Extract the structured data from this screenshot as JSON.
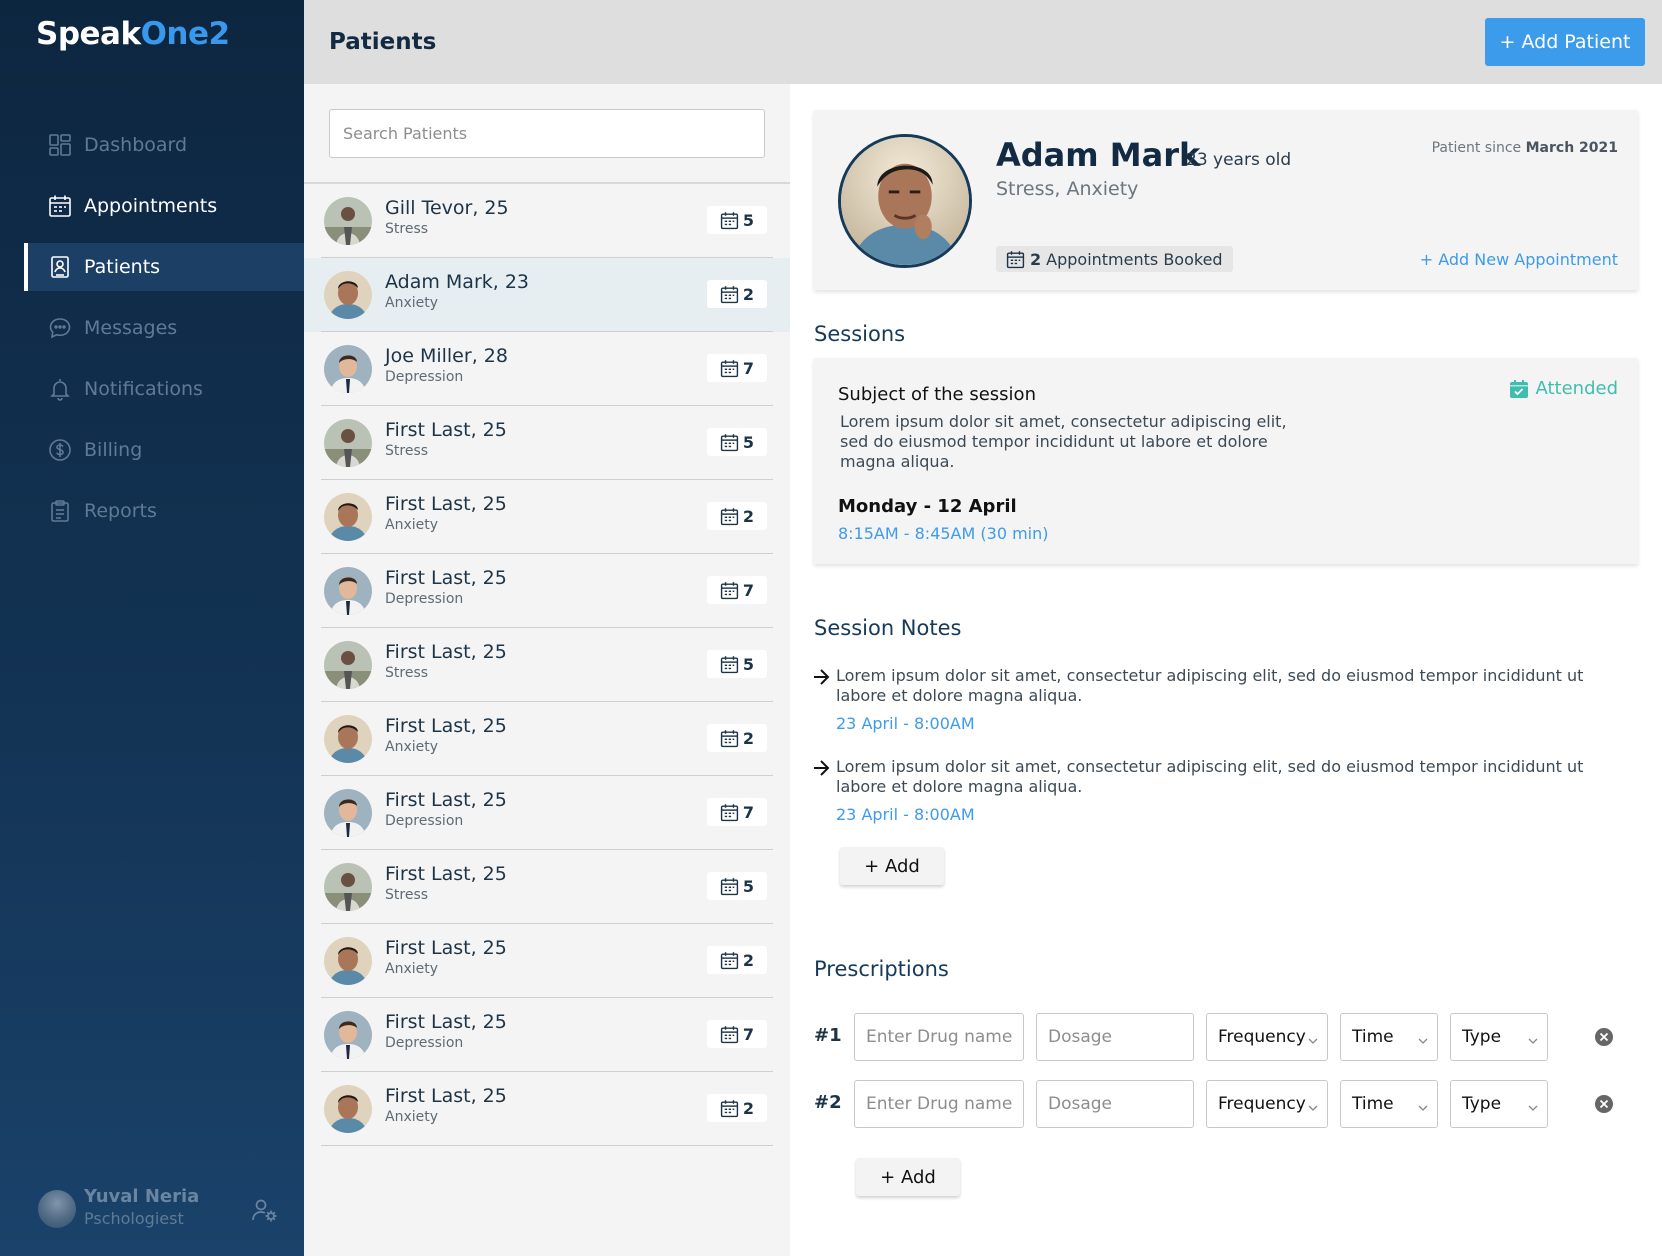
{
  "brand": {
    "part1": "Speak",
    "part2": "One2"
  },
  "sidebar": {
    "items": [
      {
        "label": "Dashboard",
        "icon": "dashboard-icon"
      },
      {
        "label": "Appointments",
        "icon": "calendar-icon"
      },
      {
        "label": "Patients",
        "icon": "patient-badge-icon"
      },
      {
        "label": "Messages",
        "icon": "chat-bubble-icon"
      },
      {
        "label": "Notifications",
        "icon": "bell-icon"
      },
      {
        "label": "Billing",
        "icon": "dollar-icon"
      },
      {
        "label": "Reports",
        "icon": "clipboard-icon"
      }
    ],
    "user": {
      "name": "Yuval Neria",
      "role": "Pschologiest",
      "settings_icon": "user-settings-icon"
    }
  },
  "header": {
    "title": "Patients",
    "add_button": "+ Add Patient"
  },
  "search": {
    "placeholder": "Search Patients"
  },
  "patients": [
    {
      "name": "Gill Tevor, 25",
      "condition": "Stress",
      "count": "5"
    },
    {
      "name": "Adam Mark, 23",
      "condition": "Anxiety",
      "count": "2"
    },
    {
      "name": "Joe Miller, 28",
      "condition": "Depression",
      "count": "7"
    },
    {
      "name": "First Last, 25",
      "condition": "Stress",
      "count": "5"
    },
    {
      "name": "First Last, 25",
      "condition": "Anxiety",
      "count": "2"
    },
    {
      "name": "First Last, 25",
      "condition": "Depression",
      "count": "7"
    },
    {
      "name": "First Last, 25",
      "condition": "Stress",
      "count": "5"
    },
    {
      "name": "First Last, 25",
      "condition": "Anxiety",
      "count": "2"
    },
    {
      "name": "First Last, 25",
      "condition": "Depression",
      "count": "7"
    },
    {
      "name": "First Last, 25",
      "condition": "Stress",
      "count": "5"
    },
    {
      "name": "First Last, 25",
      "condition": "Anxiety",
      "count": "2"
    },
    {
      "name": "First Last, 25",
      "condition": "Depression",
      "count": "7"
    },
    {
      "name": "First Last, 25",
      "condition": "Anxiety",
      "count": "2"
    }
  ],
  "profile": {
    "name": "Adam Mark",
    "age": "23 years old",
    "conditions": "Stress, Anxiety",
    "since_label": "Patient since",
    "since_value": "March 2021",
    "appointments_count": "2",
    "appointments_label": "Appointments Booked",
    "add_appointment": "+ Add New Appointment"
  },
  "sessions": {
    "title": "Sessions",
    "subject": "Subject of the session",
    "description": "Lorem ipsum dolor sit amet, consectetur adipiscing elit, sed do eiusmod tempor incididunt ut labore et dolore magna aliqua.",
    "date": "Monday - 12 April",
    "time": "8:15AM - 8:45AM (30 min)",
    "status": "Attended",
    "status_color": "#41bdb0"
  },
  "notes": {
    "title": "Session Notes",
    "items": [
      {
        "text": "Lorem ipsum dolor sit amet, consectetur adipiscing elit, sed do eiusmod tempor incididunt ut labore et dolore magna aliqua.",
        "when": "23 April - 8:00AM"
      },
      {
        "text": "Lorem ipsum dolor sit amet, consectetur adipiscing elit, sed do eiusmod tempor incididunt ut labore et dolore magna aliqua.",
        "when": "23 April - 8:00AM"
      }
    ],
    "add_label": "+ Add"
  },
  "prescriptions": {
    "title": "Prescriptions",
    "rows": [
      {
        "num": "#1",
        "drug_placeholder": "Enter Drug name",
        "dosage_placeholder": "Dosage",
        "frequency": "Frequency",
        "time": "Time",
        "type": "Type"
      },
      {
        "num": "#2",
        "drug_placeholder": "Enter Drug name",
        "dosage_placeholder": "Dosage",
        "frequency": "Frequency",
        "time": "Time",
        "type": "Type"
      }
    ],
    "add_label": "+ Add"
  },
  "colors": {
    "accent": "#3d9bec",
    "sidebar": "#133354",
    "attended": "#41bdb0"
  }
}
